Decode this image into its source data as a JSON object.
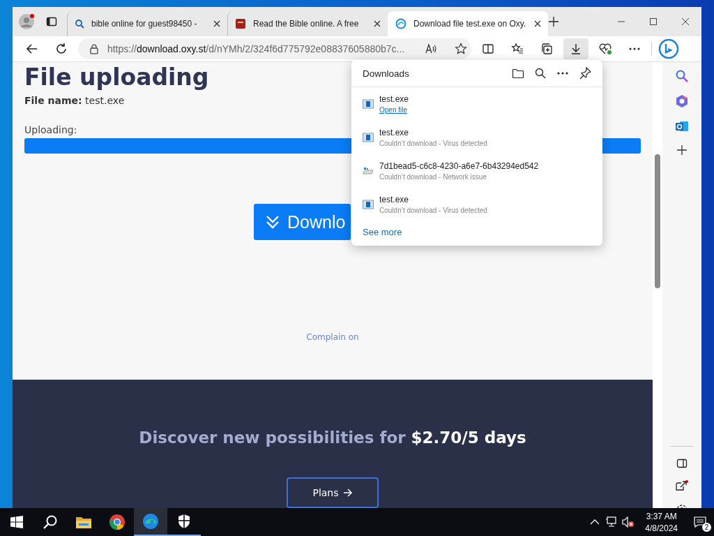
{
  "tabs": [
    {
      "kind": "search",
      "title": "bible online for guest98450 -",
      "selected": false
    },
    {
      "kind": "book",
      "title": "Read the Bible online. A free",
      "selected": false
    },
    {
      "kind": "swirl",
      "title": "Download file test.exe on Oxy.",
      "selected": true
    }
  ],
  "address": {
    "scheme": "https://",
    "host": "download.oxy.st",
    "path": "/d/nYMh/2/324f6d775792e08837605880b7c..."
  },
  "page": {
    "title": "File uploading",
    "file_name_label": "File name:",
    "file_name": "test.exe",
    "progress_label": "Uploading:",
    "progress": {
      "level": 1
    },
    "download_button": "Downlo",
    "complain_link": "Complain on",
    "promo_text": "Discover new possibilities for",
    "promo_price": "$2.70/5 days",
    "plans_button": "Plans"
  },
  "downloads": {
    "title": "Downloads",
    "items": [
      {
        "kind": "done",
        "name": "test.exe",
        "detail": "Open file"
      },
      {
        "kind": "failed",
        "name": "test.exe",
        "detail": "Couldn’t download - Virus detected"
      },
      {
        "kind": "failed",
        "name": "7d1bead5-c6c8-4230-a6e7-6b43294ed542",
        "detail": "Couldn’t download - Network issue"
      },
      {
        "kind": "failed",
        "name": "test.exe",
        "detail": "Couldn’t download - Virus detected"
      }
    ],
    "see_more": "See more"
  },
  "taskbar": {
    "time": "3:37 AM",
    "date": "4/8/2024",
    "notifications": "2"
  }
}
